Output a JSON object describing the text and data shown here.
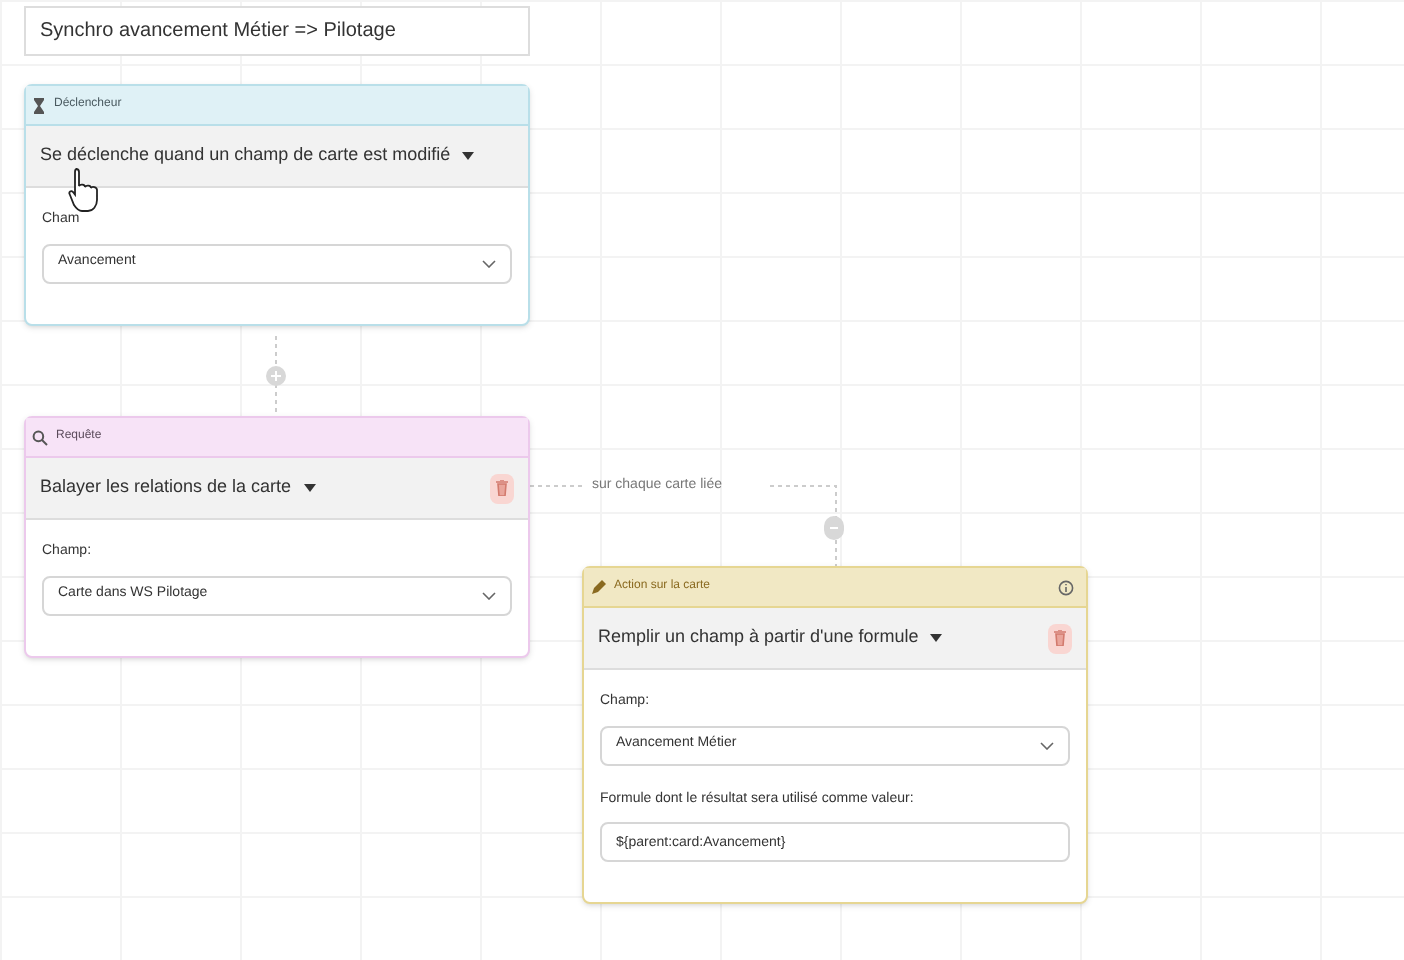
{
  "title_field": {
    "value": "Synchro avancement Métier => Pilotage"
  },
  "cards": [
    {
      "kind": "trigger",
      "header": "Déclencheur",
      "selector": "Se déclenche quand un champ de carte est modifié",
      "deletable": false,
      "info": false,
      "fields": [
        {
          "kind": "select",
          "label": "Cham",
          "value": "Avancement"
        }
      ]
    },
    {
      "kind": "query",
      "header": "Requête",
      "selector": "Balayer les relations de la carte",
      "deletable": true,
      "info": false,
      "fields": [
        {
          "kind": "select",
          "label": "Champ:",
          "value": "Carte dans WS Pilotage"
        }
      ]
    },
    {
      "kind": "action",
      "header": "Action sur la carte",
      "selector": "Remplir un champ à partir d'une formule",
      "deletable": true,
      "info": true,
      "fields": [
        {
          "kind": "select",
          "label": "Champ:",
          "value": "Avancement Métier"
        },
        {
          "kind": "text",
          "label": "Formule dont le résultat sera utilisé comme valeur:",
          "value": "${parent:card:Avancement}"
        }
      ]
    }
  ],
  "branch_label": "sur chaque carte liée"
}
